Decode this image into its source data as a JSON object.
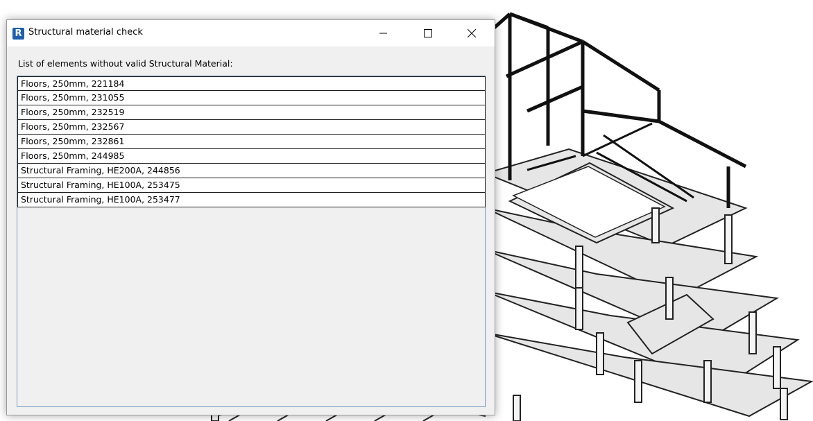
{
  "window": {
    "title": "Structural material check",
    "app_icon_letter": "R",
    "accent_color": "#1e5fae"
  },
  "controls": {
    "minimize_icon": "minimize-icon",
    "maximize_icon": "maximize-icon",
    "close_icon": "close-icon"
  },
  "list_label": "List of elements without valid Structural Material:",
  "items": [
    "Floors, 250mm, 221184",
    "Floors, 250mm, 231055",
    "Floors, 250mm, 232519",
    "Floors, 250mm, 232567",
    "Floors, 250mm, 232861",
    "Floors, 250mm, 244985",
    "Structural Framing, HE200A, 244856",
    "Structural Framing, HE100A, 253475",
    "Structural Framing, HE100A, 253477"
  ]
}
